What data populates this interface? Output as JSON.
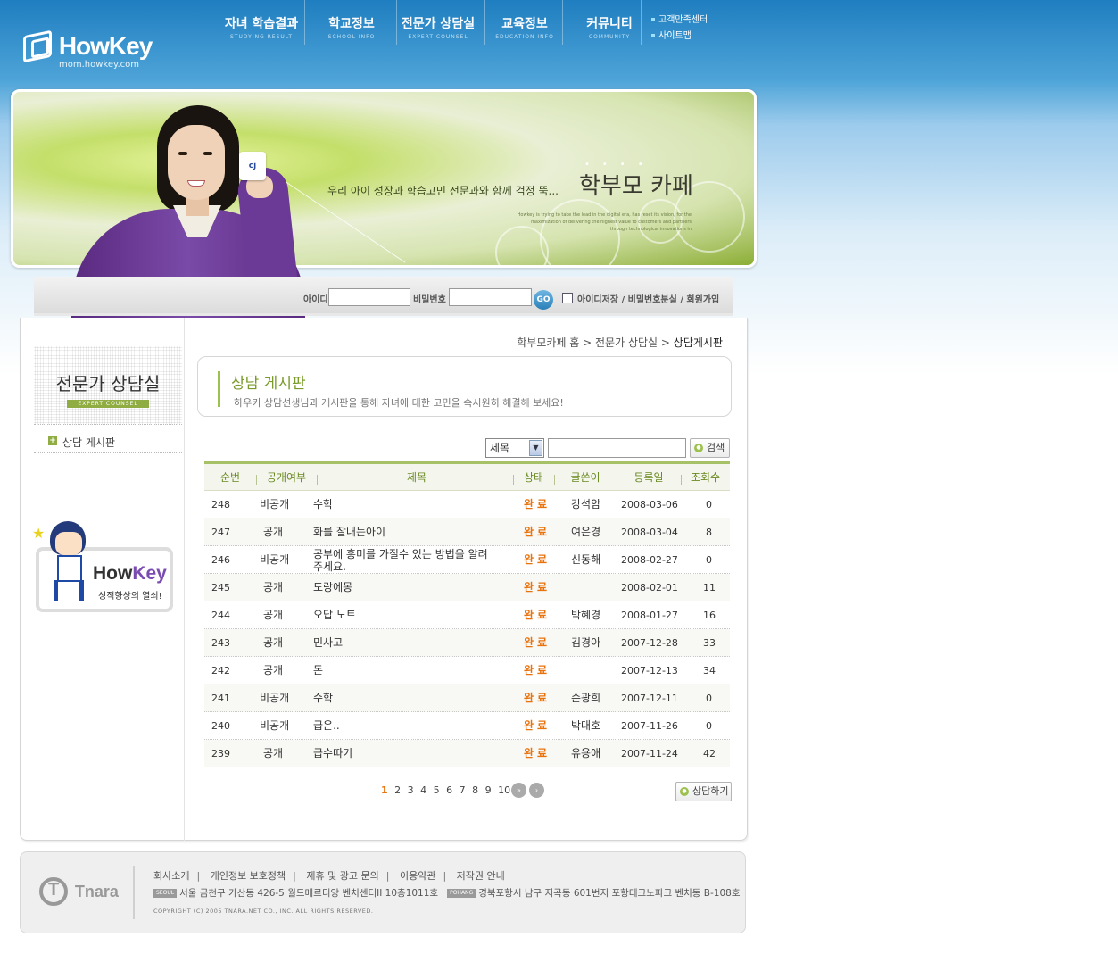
{
  "brand": {
    "name": "HowKey",
    "domain": "mom.howkey.com"
  },
  "gnb": [
    {
      "ko": "자녀 학습결과",
      "en": "STUDYING RESULT"
    },
    {
      "ko": "학교정보",
      "en": "SCHOOL INFO"
    },
    {
      "ko": "전문가 상담실",
      "en": "EXPERT COUNSEL"
    },
    {
      "ko": "교육정보",
      "en": "EDUCATION INFO"
    },
    {
      "ko": "커뮤니티",
      "en": "COMMUNITY"
    }
  ],
  "quick_links": [
    "고객만족센터",
    "사이트맵"
  ],
  "banner": {
    "tagline": "우리 아이 성장과 학습고민 전문과와 함께 걱정 뚝...",
    "cafe_title": "학부모 카페",
    "cup_text": "cj",
    "small_text": "Howkey is trying to take the lead in the digital era, has reset its vision, for the maximization of delivering the highest value to customers and partners through technological innovations in"
  },
  "login": {
    "id_label": "아이디",
    "pw_label": "비밀번호",
    "go_label": "GO",
    "links": "아이디저장 / 비밀번호분실 / 회원가입"
  },
  "sidebar": {
    "title_ko": "전문가 상담실",
    "title_en": "EXPERT COUNSEL",
    "menu_item": "상담 게시판",
    "mascot_brand_a": "How",
    "mascot_brand_b": "Key",
    "mascot_slogan": "성적향상의 열쇠!"
  },
  "breadcrumb": {
    "home": "학부모카페 홈",
    "sep": ">",
    "mid": "전문가 상담실",
    "current": "상담게시판"
  },
  "board_header": {
    "title": "상담 게시판",
    "desc": "하우키 상담선생님과 게시판을 통해 자녀에 대한 고민을 속시원히 해결해 보세요!"
  },
  "search": {
    "select_value": "제목",
    "button": "검색"
  },
  "table": {
    "columns": [
      "순번",
      "공개여부",
      "제목",
      "상태",
      "글쓴이",
      "등록일",
      "조회수"
    ],
    "rows": [
      {
        "no": "248",
        "open": "비공개",
        "title": "수학",
        "status": "완료",
        "writer": "강석암",
        "date": "2008-03-06",
        "views": "0"
      },
      {
        "no": "247",
        "open": "공개",
        "title": "화를 잘내는아이",
        "status": "완료",
        "writer": "여은경",
        "date": "2008-03-04",
        "views": "8"
      },
      {
        "no": "246",
        "open": "비공개",
        "title": "공부에 흥미를 가질수 있는 방법을 알려주세요.",
        "status": "완료",
        "writer": "신동해",
        "date": "2008-02-27",
        "views": "0"
      },
      {
        "no": "245",
        "open": "공개",
        "title": "도랑에몽",
        "status": "완료",
        "writer": "",
        "date": "2008-02-01",
        "views": "11"
      },
      {
        "no": "244",
        "open": "공개",
        "title": "오답 노트",
        "status": "완료",
        "writer": "박혜경",
        "date": "2008-01-27",
        "views": "16"
      },
      {
        "no": "243",
        "open": "공개",
        "title": "민사고",
        "status": "완료",
        "writer": "김경아",
        "date": "2007-12-28",
        "views": "33"
      },
      {
        "no": "242",
        "open": "공개",
        "title": "돈",
        "status": "완료",
        "writer": "",
        "date": "2007-12-13",
        "views": "34"
      },
      {
        "no": "241",
        "open": "비공개",
        "title": "수학",
        "status": "완료",
        "writer": "손광희",
        "date": "2007-12-11",
        "views": "0"
      },
      {
        "no": "240",
        "open": "비공개",
        "title": "급은..",
        "status": "완료",
        "writer": "박대호",
        "date": "2007-11-26",
        "views": "0"
      },
      {
        "no": "239",
        "open": "공개",
        "title": "급수따기",
        "status": "완료",
        "writer": "유용애",
        "date": "2007-11-24",
        "views": "42"
      }
    ]
  },
  "pagination": {
    "pages": [
      "1",
      "2",
      "3",
      "4",
      "5",
      "6",
      "7",
      "8",
      "9",
      "10"
    ],
    "current": "1"
  },
  "write_button": "상담하기",
  "footer": {
    "company": "Tnara",
    "links": [
      "회사소개",
      "개인정보 보호정책",
      "제휴 및 광고 문의",
      "이용약관",
      "저작권 안내"
    ],
    "seoul_tag": "SEOUL",
    "seoul_addr": "서울 금천구 가산동 426-5 월드메르디앙 벤처센터II 10층1011호",
    "pohang_tag": "POHANG",
    "pohang_addr": "경북포항시 남구 지곡동 601번지 포항테크노파크 벤처동 B-108호",
    "copyright": "COPYRIGHT (C) 2005 TNARA.NET CO., INC. ALL RIGHTS RESERVED."
  },
  "colors": {
    "accent_green": "#8fad42",
    "status_orange": "#e8720c",
    "header_blue": "#1f7ec0"
  }
}
